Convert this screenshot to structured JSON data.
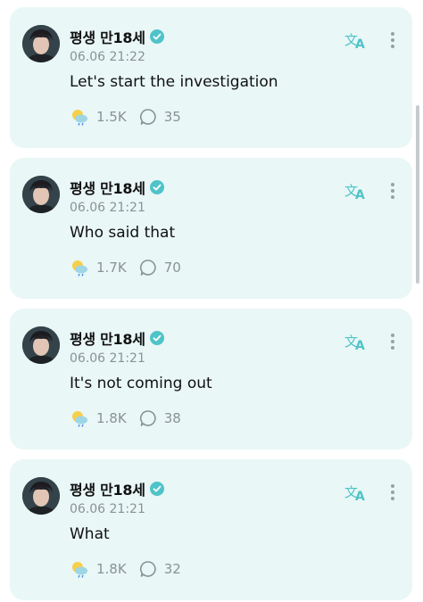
{
  "colors": {
    "card_background": "#e9f7f6",
    "accent": "#4fc3c8",
    "secondary_text": "#8a9296",
    "primary_text": "#111111"
  },
  "posts": [
    {
      "author": "평생 만18세",
      "timestamp": "06.06 21:22",
      "text": "Let's start the investigation",
      "reactions": "1.5K",
      "comments": "35"
    },
    {
      "author": "평생 만18세",
      "timestamp": "06.06 21:21",
      "text": "Who said that",
      "reactions": "1.7K",
      "comments": "70"
    },
    {
      "author": "평생 만18세",
      "timestamp": "06.06 21:21",
      "text": "It's not coming out",
      "reactions": "1.8K",
      "comments": "38"
    },
    {
      "author": "평생 만18세",
      "timestamp": "06.06 21:21",
      "text": "What",
      "reactions": "1.8K",
      "comments": "32"
    }
  ],
  "icons": {
    "verified": "verified-check-icon",
    "translate": "translate-icon",
    "more": "more-vertical-icon",
    "reaction": "weather-reaction-icon",
    "comment": "comment-bubble-icon"
  }
}
